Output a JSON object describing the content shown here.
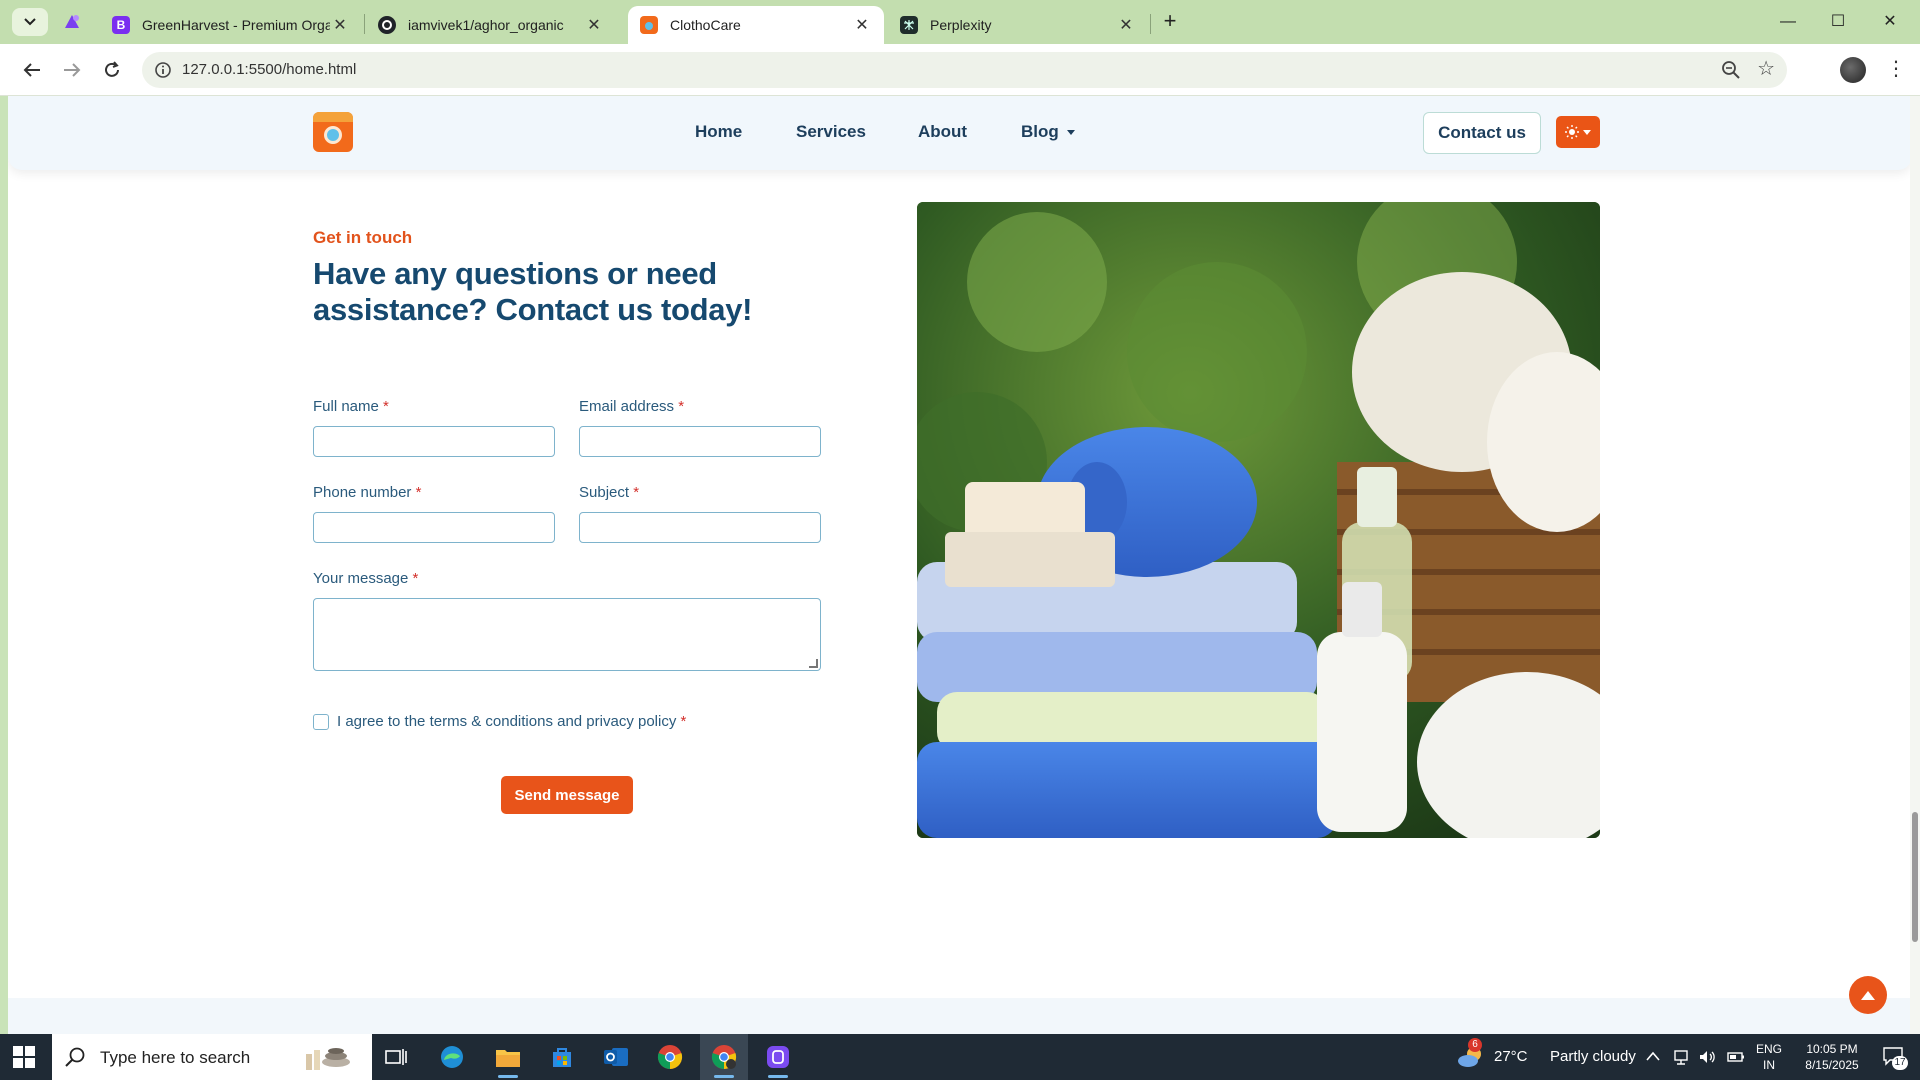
{
  "browser": {
    "tabs": [
      {
        "title": "GreenHarvest - Premium Organ",
        "favicon_letter": "B",
        "favicon_color": "#7a2ff0"
      },
      {
        "title": "iamvivek1/aghor_organic",
        "favicon_color": "#1f2328"
      },
      {
        "title": "ClothoCare",
        "favicon_color": "#f26a1b",
        "active": true
      },
      {
        "title": "Perplexity",
        "favicon_color": "#1f2d2b"
      }
    ],
    "url": "127.0.0.1:5500/home.html"
  },
  "site": {
    "nav": [
      {
        "label": "Home"
      },
      {
        "label": "Services"
      },
      {
        "label": "About"
      },
      {
        "label": "Blog",
        "has_dropdown": true
      }
    ],
    "contact_button": "Contact us",
    "theme_button_icon": "sun-icon"
  },
  "contact": {
    "eyebrow": "Get in touch",
    "headline": "Have any questions or need assistance? Contact us today!",
    "fields": {
      "full_name": {
        "label": "Full name",
        "value": "",
        "required": "*"
      },
      "email": {
        "label": "Email address",
        "value": "",
        "required": "*"
      },
      "phone": {
        "label": "Phone number",
        "value": "",
        "required": "*"
      },
      "subject": {
        "label": "Subject",
        "value": "",
        "required": "*"
      },
      "message": {
        "label": "Your message",
        "value": "",
        "required": "*"
      }
    },
    "agree_text": "I agree to the terms & conditions and privacy policy",
    "agree_required": "*",
    "agree_checked": false,
    "send_button": "Send message"
  },
  "taskbar": {
    "search_placeholder": "Type here to search",
    "weather": {
      "temp": "27°C",
      "condition": "Partly cloudy",
      "badge": "6"
    },
    "language": [
      "ENG",
      "IN"
    ],
    "time": "10:05 PM",
    "date": "8/15/2025",
    "notifications": "17"
  },
  "colors": {
    "accent": "#e8541a",
    "heading": "#16496f",
    "tab_strip": "#c3deaf"
  }
}
